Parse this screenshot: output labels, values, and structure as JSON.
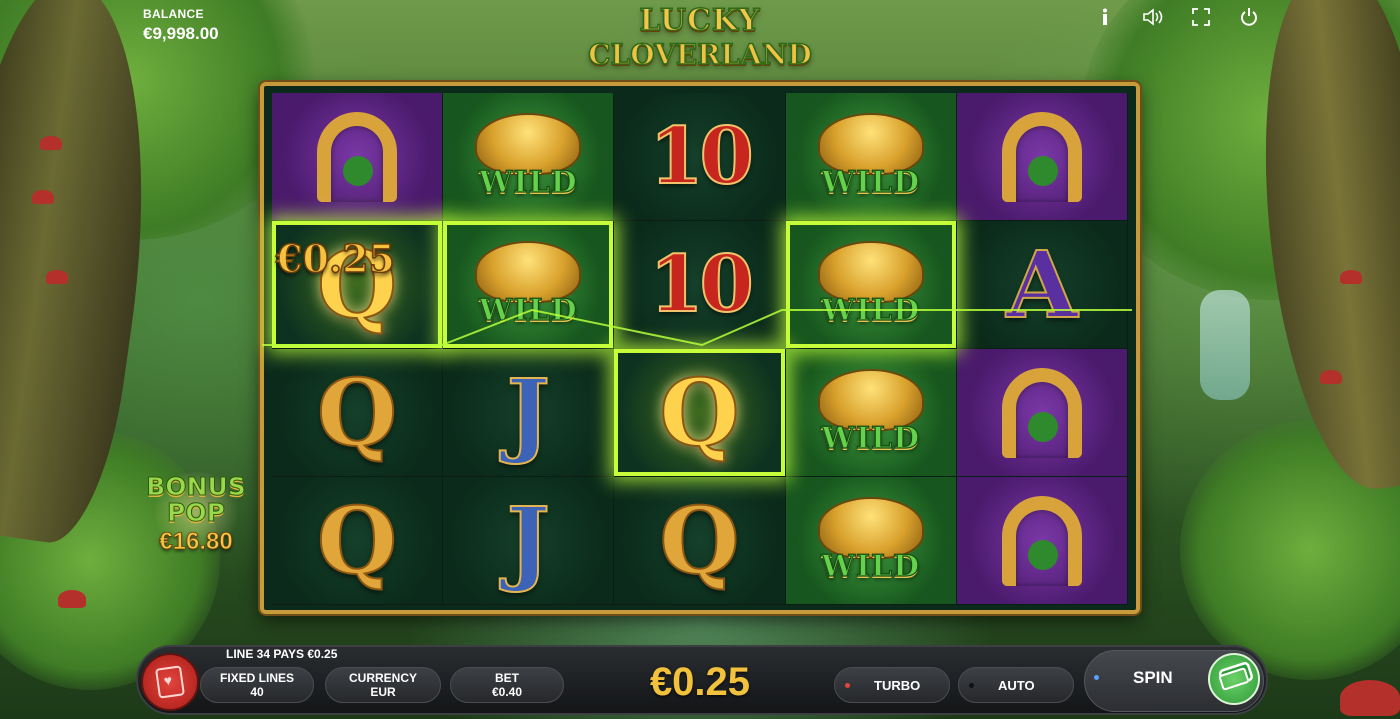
{
  "hud": {
    "balance_label": "BALANCE",
    "balance_value": "€9,998.00",
    "icons": [
      "info-icon",
      "sound-icon",
      "fullscreen-icon",
      "power-icon"
    ]
  },
  "logo": {
    "line1": "LUCKY",
    "line2": "CLOVERLAND"
  },
  "reels": [
    [
      "horseshoe",
      "wild",
      "10",
      "wild",
      "horseshoe"
    ],
    [
      "Q",
      "wild",
      "10",
      "wild",
      "A"
    ],
    [
      "Q",
      "J",
      "Q",
      "wild",
      "horseshoe"
    ],
    [
      "Q",
      "J",
      "Q",
      "wild",
      "horseshoe"
    ]
  ],
  "symbols": {
    "wild_label": "WILD",
    "ten": "10",
    "q": "Q",
    "j": "J",
    "a": "A"
  },
  "win": {
    "amount_overlay": "€0.25",
    "line_text": "LINE 34 PAYS €0.25",
    "total": "€0.25"
  },
  "bonus_pop": {
    "title_line1": "BONUS",
    "title_line2": "POP",
    "amount": "€16.80"
  },
  "controls": {
    "fixed_lines_label": "FIXED LINES",
    "fixed_lines_value": "40",
    "currency_label": "CURRENCY",
    "currency_value": "EUR",
    "bet_label": "BET",
    "bet_value": "€0.40",
    "turbo_label": "TURBO",
    "auto_label": "AUTO",
    "spin_label": "SPIN"
  },
  "colors": {
    "win_highlight": "#c6ff3a",
    "gold": "#f3c23c",
    "turbo_dot": "#e0463c",
    "auto_dot": "#2b2d30",
    "spin_dot": "#5aa0ff"
  }
}
